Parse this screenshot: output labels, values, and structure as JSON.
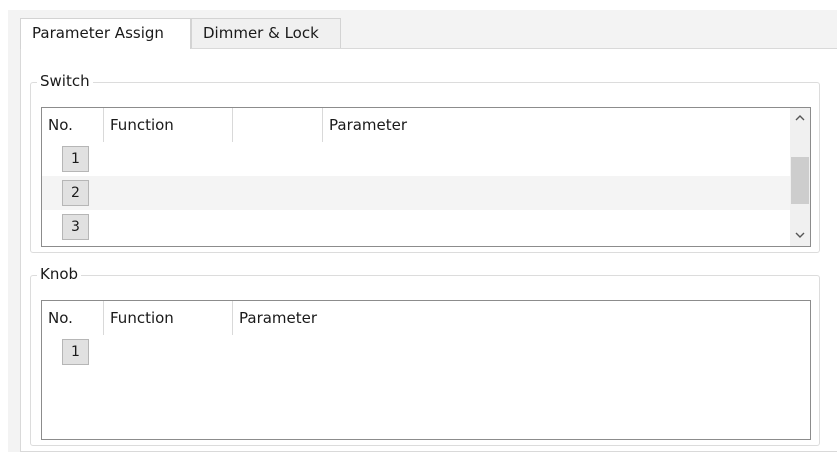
{
  "tabs": [
    {
      "label": "Parameter Assign",
      "active": true
    },
    {
      "label": "Dimmer & Lock",
      "active": false
    }
  ],
  "switch_group": {
    "title": "Switch",
    "columns": [
      "No.",
      "Function",
      "",
      "Parameter"
    ],
    "rows": [
      {
        "no": "1",
        "function": "",
        "parameter": ""
      },
      {
        "no": "2",
        "function": "",
        "parameter": ""
      },
      {
        "no": "3",
        "function": "",
        "parameter": ""
      }
    ],
    "scrollbar": {
      "up_icon": "chevron-up-icon",
      "down_icon": "chevron-down-icon"
    }
  },
  "knob_group": {
    "title": "Knob",
    "columns": [
      "No.",
      "Function",
      "Parameter"
    ],
    "rows": [
      {
        "no": "1",
        "function": "",
        "parameter": ""
      }
    ]
  },
  "colors": {
    "window_bg": "#f3f3f3",
    "panel_bg": "#ffffff",
    "grid_border": "#8c8c8c",
    "alt_row": "#f4f4f4",
    "button_bg": "#e1e1e1",
    "scroll_thumb": "#cdcdcd"
  }
}
